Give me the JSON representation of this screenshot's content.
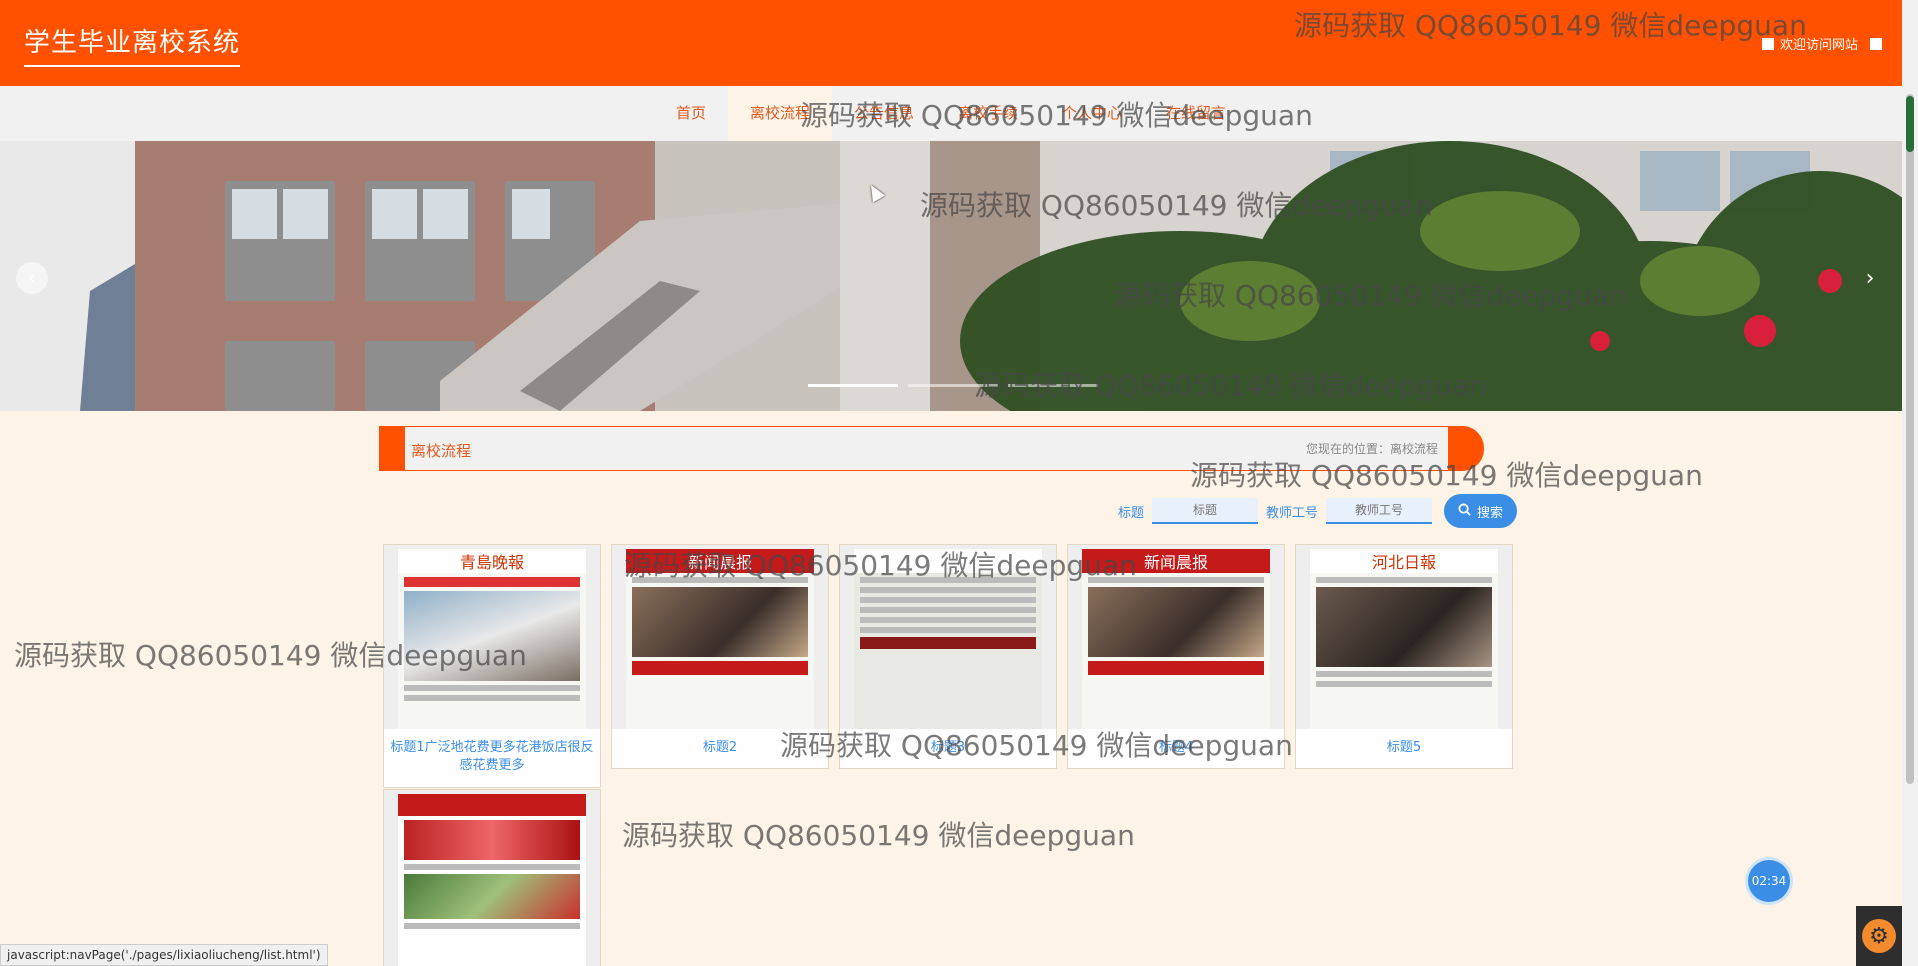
{
  "header": {
    "logo": "学生毕业离校系统",
    "welcome": "欢迎访问网站"
  },
  "nav": {
    "items": [
      {
        "label": "首页",
        "active": false
      },
      {
        "label": "离校流程",
        "active": true
      },
      {
        "label": "公告信息",
        "active": false
      },
      {
        "label": "离校手续",
        "active": false
      },
      {
        "label": "个人中心",
        "active": false
      },
      {
        "label": "在线留言",
        "active": false
      }
    ]
  },
  "banner": {
    "prev_icon": "chevron-left-icon",
    "next_icon": "chevron-right-icon",
    "indicators": 3,
    "active_indicator": 0
  },
  "section": {
    "title": "离校流程",
    "breadcrumb": "您现在的位置：离校流程"
  },
  "search": {
    "title_label": "标题",
    "title_placeholder": "标题",
    "teacher_label": "教师工号",
    "teacher_placeholder": "教师工号",
    "button_label": "搜索",
    "button_icon": "search-icon"
  },
  "cards": [
    {
      "caption": "标题1广泛地花费更多花港饭店很反感花费更多",
      "masthead": "青島晚報"
    },
    {
      "caption": "标题2",
      "masthead": "新闻晨报"
    },
    {
      "caption": "标题3",
      "masthead": ""
    },
    {
      "caption": "标题4",
      "masthead": "新闻晨报"
    },
    {
      "caption": "标题5",
      "masthead": "河北日報"
    },
    {
      "caption": "",
      "masthead": ""
    }
  ],
  "watermark": "源码获取 QQ86050149 微信deepguan",
  "status_url": "javascript:navPage('./pages/lixiaoliucheng/list.html')",
  "timer": "02:34",
  "colors": {
    "brand": "#ff5100",
    "link": "#3a8ee6",
    "page_bg": "#fdf3e7"
  }
}
